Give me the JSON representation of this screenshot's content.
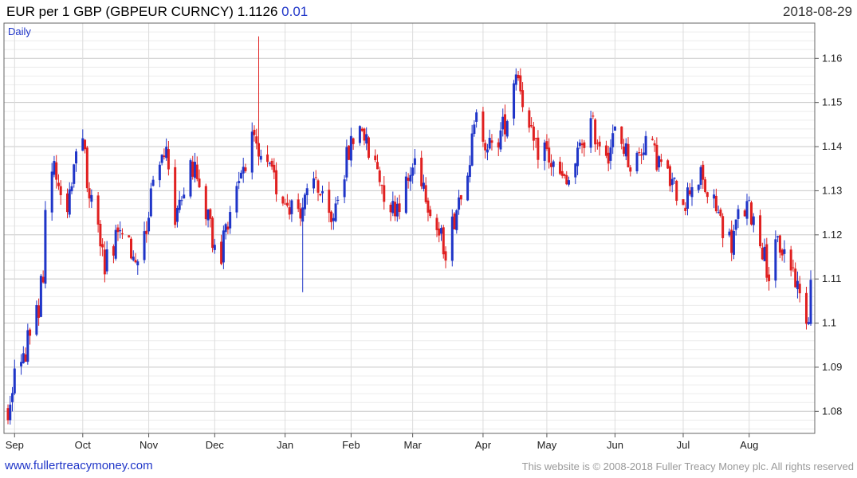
{
  "header": {
    "title": "EUR per 1 GBP (GBPEUR CURNCY) 1.1126",
    "change": "0.01",
    "date": "2018-08-29"
  },
  "footer": {
    "site": "www.fullertreacymoney.com",
    "copyright": "This website is © 2008-2018 Fuller Treacy Money plc. All rights reserved"
  },
  "colors": {
    "up": "#1f35c8",
    "down": "#e02020",
    "grid": "#d4d4d4",
    "frame": "#666666",
    "accent": "#1f35c8"
  },
  "chart_data": {
    "type": "candlestick",
    "period_label": "Daily",
    "ylim": [
      1.075,
      1.168
    ],
    "y_ticks": [
      1.08,
      1.09,
      1.1,
      1.11,
      1.12,
      1.13,
      1.14,
      1.15,
      1.16
    ],
    "y_tick_labels": [
      "1.08",
      "1.09",
      "1.1",
      "1.11",
      "1.12",
      "1.13",
      "1.14",
      "1.15",
      "1.16"
    ],
    "x_start": "2017-08-29",
    "x_end": "2018-08-29",
    "x_ticks": [
      {
        "label": "Sep",
        "date": "2017-09-01"
      },
      {
        "label": "Oct",
        "date": "2017-10-02"
      },
      {
        "label": "Nov",
        "date": "2017-11-01"
      },
      {
        "label": "Dec",
        "date": "2017-12-01"
      },
      {
        "label": "Jan",
        "date": "2018-01-02"
      },
      {
        "label": "Feb",
        "date": "2018-02-01"
      },
      {
        "label": "Mar",
        "date": "2018-03-01"
      },
      {
        "label": "Apr",
        "date": "2018-04-02"
      },
      {
        "label": "May",
        "date": "2018-05-01"
      },
      {
        "label": "Jun",
        "date": "2018-06-01"
      },
      {
        "label": "Jul",
        "date": "2018-07-02"
      },
      {
        "label": "Aug",
        "date": "2018-08-01"
      }
    ],
    "close_path": [
      [
        "2017-08-29",
        1.08
      ],
      [
        "2017-09-01",
        1.088
      ],
      [
        "2017-09-05",
        1.092
      ],
      [
        "2017-09-08",
        1.098
      ],
      [
        "2017-09-12",
        1.104
      ],
      [
        "2017-09-14",
        1.112
      ],
      [
        "2017-09-15",
        1.126
      ],
      [
        "2017-09-18",
        1.137
      ],
      [
        "2017-09-21",
        1.133
      ],
      [
        "2017-09-25",
        1.128
      ],
      [
        "2017-09-28",
        1.136
      ],
      [
        "2017-10-02",
        1.14
      ],
      [
        "2017-10-05",
        1.13
      ],
      [
        "2017-10-09",
        1.121
      ],
      [
        "2017-10-12",
        1.114
      ],
      [
        "2017-10-16",
        1.118
      ],
      [
        "2017-10-19",
        1.122
      ],
      [
        "2017-10-23",
        1.117
      ],
      [
        "2017-10-26",
        1.111
      ],
      [
        "2017-10-30",
        1.12
      ],
      [
        "2017-11-02",
        1.128
      ],
      [
        "2017-11-06",
        1.135
      ],
      [
        "2017-11-09",
        1.141
      ],
      [
        "2017-11-13",
        1.124
      ],
      [
        "2017-11-16",
        1.13
      ],
      [
        "2017-11-20",
        1.138
      ],
      [
        "2017-11-23",
        1.132
      ],
      [
        "2017-11-27",
        1.126
      ],
      [
        "2017-11-30",
        1.119
      ],
      [
        "2017-12-04",
        1.116
      ],
      [
        "2017-12-07",
        1.124
      ],
      [
        "2017-12-11",
        1.132
      ],
      [
        "2017-12-14",
        1.136
      ],
      [
        "2017-12-18",
        1.141
      ],
      [
        "2017-12-21",
        1.137
      ],
      [
        "2017-12-26",
        1.134
      ],
      [
        "2017-12-29",
        1.131
      ],
      [
        "2018-01-02",
        1.128
      ],
      [
        "2018-01-05",
        1.127
      ],
      [
        "2018-01-09",
        1.126
      ],
      [
        "2018-01-12",
        1.128
      ],
      [
        "2018-01-16",
        1.133
      ],
      [
        "2018-01-19",
        1.127
      ],
      [
        "2018-01-23",
        1.122
      ],
      [
        "2018-01-26",
        1.13
      ],
      [
        "2018-01-30",
        1.137
      ],
      [
        "2018-02-02",
        1.142
      ],
      [
        "2018-02-06",
        1.145
      ],
      [
        "2018-02-09",
        1.138
      ],
      [
        "2018-02-13",
        1.135
      ],
      [
        "2018-02-16",
        1.13
      ],
      [
        "2018-02-20",
        1.126
      ],
      [
        "2018-02-23",
        1.128
      ],
      [
        "2018-02-27",
        1.132
      ],
      [
        "2018-03-02",
        1.137
      ],
      [
        "2018-03-06",
        1.132
      ],
      [
        "2018-03-09",
        1.126
      ],
      [
        "2018-03-13",
        1.12
      ],
      [
        "2018-03-16",
        1.117
      ],
      [
        "2018-03-20",
        1.124
      ],
      [
        "2018-03-23",
        1.131
      ],
      [
        "2018-03-27",
        1.138
      ],
      [
        "2018-03-30",
        1.146
      ],
      [
        "2018-04-03",
        1.142
      ],
      [
        "2018-04-06",
        1.139
      ],
      [
        "2018-04-10",
        1.143
      ],
      [
        "2018-04-13",
        1.147
      ],
      [
        "2018-04-17",
        1.158
      ],
      [
        "2018-04-19",
        1.154
      ],
      [
        "2018-04-23",
        1.143
      ],
      [
        "2018-04-26",
        1.139
      ],
      [
        "2018-04-30",
        1.14
      ],
      [
        "2018-05-03",
        1.136
      ],
      [
        "2018-05-07",
        1.133
      ],
      [
        "2018-05-10",
        1.131
      ],
      [
        "2018-05-14",
        1.136
      ],
      [
        "2018-05-17",
        1.141
      ],
      [
        "2018-05-21",
        1.145
      ],
      [
        "2018-05-24",
        1.142
      ],
      [
        "2018-05-29",
        1.139
      ],
      [
        "2018-06-01",
        1.143
      ],
      [
        "2018-06-05",
        1.14
      ],
      [
        "2018-06-08",
        1.136
      ],
      [
        "2018-06-12",
        1.138
      ],
      [
        "2018-06-15",
        1.142
      ],
      [
        "2018-06-19",
        1.138
      ],
      [
        "2018-06-22",
        1.136
      ],
      [
        "2018-06-26",
        1.132
      ],
      [
        "2018-06-29",
        1.13
      ],
      [
        "2018-07-03",
        1.128
      ],
      [
        "2018-07-06",
        1.132
      ],
      [
        "2018-07-10",
        1.133
      ],
      [
        "2018-07-13",
        1.129
      ],
      [
        "2018-07-17",
        1.126
      ],
      [
        "2018-07-20",
        1.122
      ],
      [
        "2018-07-24",
        1.118
      ],
      [
        "2018-07-27",
        1.124
      ],
      [
        "2018-07-31",
        1.126
      ],
      [
        "2018-08-03",
        1.124
      ],
      [
        "2018-08-07",
        1.117
      ],
      [
        "2018-08-10",
        1.111
      ],
      [
        "2018-08-14",
        1.118
      ],
      [
        "2018-08-17",
        1.116
      ],
      [
        "2018-08-21",
        1.112
      ],
      [
        "2018-08-24",
        1.106
      ],
      [
        "2018-08-28",
        1.101
      ],
      [
        "2018-08-29",
        1.1126
      ]
    ],
    "spikes": [
      {
        "date": "2017-12-21",
        "high": 1.165
      },
      {
        "date": "2018-01-10",
        "low": 1.107
      }
    ]
  }
}
